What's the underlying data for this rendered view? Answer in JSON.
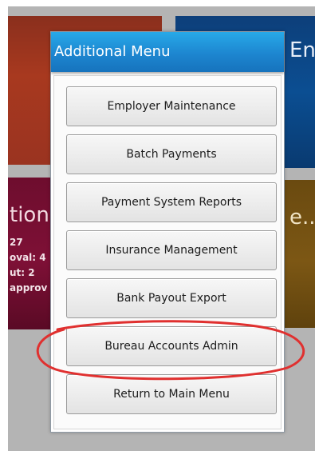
{
  "background_tiles": {
    "top_right_title": "En",
    "middle_left_title": "tion",
    "middle_left_stats": [
      "27",
      "oval: 4",
      "ut: 2",
      "approv"
    ],
    "middle_right_title": "e..."
  },
  "modal": {
    "title": "Additional Menu",
    "buttons": [
      "Employer Maintenance",
      "Batch Payments",
      "Payment System Reports",
      "Insurance Management",
      "Bank Payout Export",
      "Bureau Accounts Admin",
      "Return to Main Menu"
    ]
  },
  "colors": {
    "header_blue": "#1d86d0",
    "annotation_red": "#e0302f"
  }
}
